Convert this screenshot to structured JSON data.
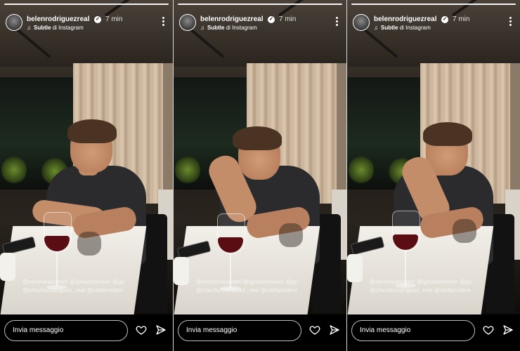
{
  "stories": [
    {
      "username": "belenrodriguezreal",
      "time": "7 min",
      "music": {
        "title": "Subtle",
        "source_prefix": "di",
        "source": "Instagram"
      },
      "tags": [
        "@veronicaozzani @ignaziomoser @gu",
        "@chechurodriguez_real @stefanodem"
      ],
      "reply_placeholder": "Invia messaggio"
    },
    {
      "username": "belenrodriguezreal",
      "time": "7 min",
      "music": {
        "title": "Subtle",
        "source_prefix": "di",
        "source": "Instagram"
      },
      "tags": [
        "@veronicaozzani @ignaziomoser @gu",
        "@chechurodriguez_real @stefanodem"
      ],
      "reply_placeholder": "Invia messaggio"
    },
    {
      "username": "belenrodriguezreal",
      "time": "7 min",
      "music": {
        "title": "Subtle",
        "source_prefix": "di",
        "source": "Instagram"
      },
      "tags": [
        "@veronicaozzani @ignaziomoser @gu",
        "@chechurodriguez_real @stefanodem"
      ],
      "reply_placeholder": "Invia messaggio"
    }
  ],
  "icons": {
    "verified": "verified-badge-icon",
    "music": "music-note-icon",
    "more": "more-vertical-icon",
    "like": "heart-icon",
    "share": "send-icon"
  },
  "colors": {
    "background": "#000000",
    "text": "#ffffff",
    "wine": "#5a0d12"
  }
}
